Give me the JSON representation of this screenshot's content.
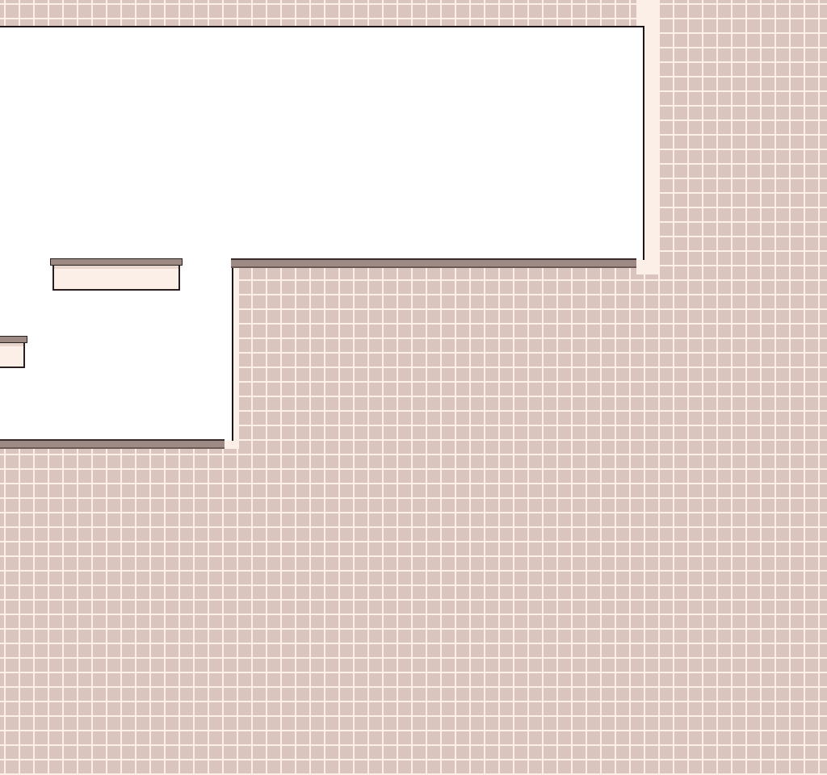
{
  "scene": {
    "palette": {
      "wall": "#d9c5bd",
      "grout": "#fbefe8",
      "room": "#ffffff",
      "outline": "#1e1616",
      "ledge": "#9e8a84",
      "platform_face": "#fbefe8"
    }
  }
}
